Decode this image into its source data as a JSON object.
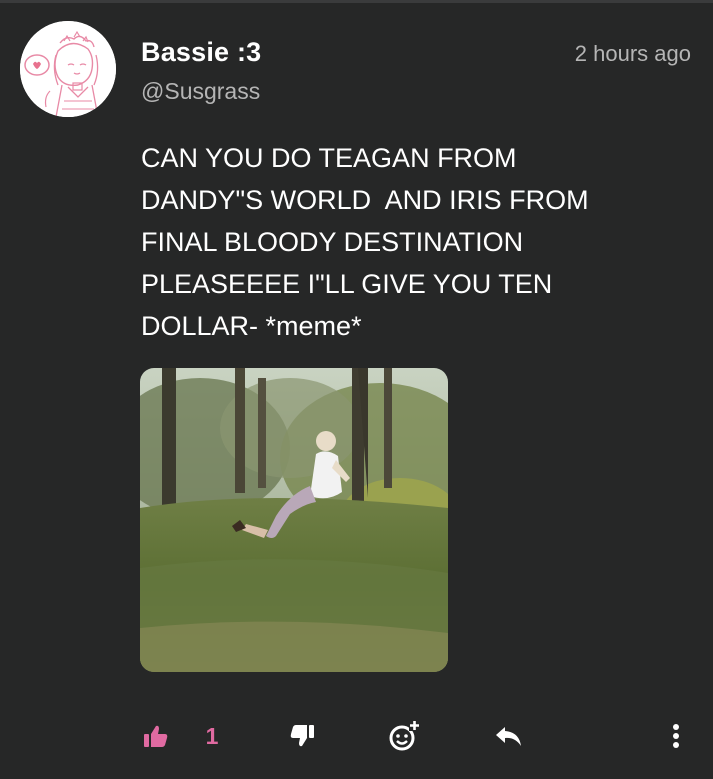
{
  "post": {
    "author_name": "Bassie :3",
    "author_handle": "@Susgrass",
    "timestamp": "2 hours ago",
    "text": "CAN YOU DO TEAGAN FROM\nDANDY\"S WORLD  AND IRIS FROM\nFINAL BLOODY DESTINATION\nPLEASEEEE I\"LL GIVE YOU TEN\nDOLLAR- *meme*"
  },
  "actions": {
    "like_count": "1",
    "like_color": "#e06aa1",
    "icons": [
      "thumbs-up-icon",
      "thumbs-down-icon",
      "add-reaction-icon",
      "reply-icon",
      "more-icon"
    ]
  },
  "colors": {
    "background": "#262727",
    "text_primary": "#ffffff",
    "text_secondary": "#b5b5b5",
    "accent": "#e06aa1"
  }
}
